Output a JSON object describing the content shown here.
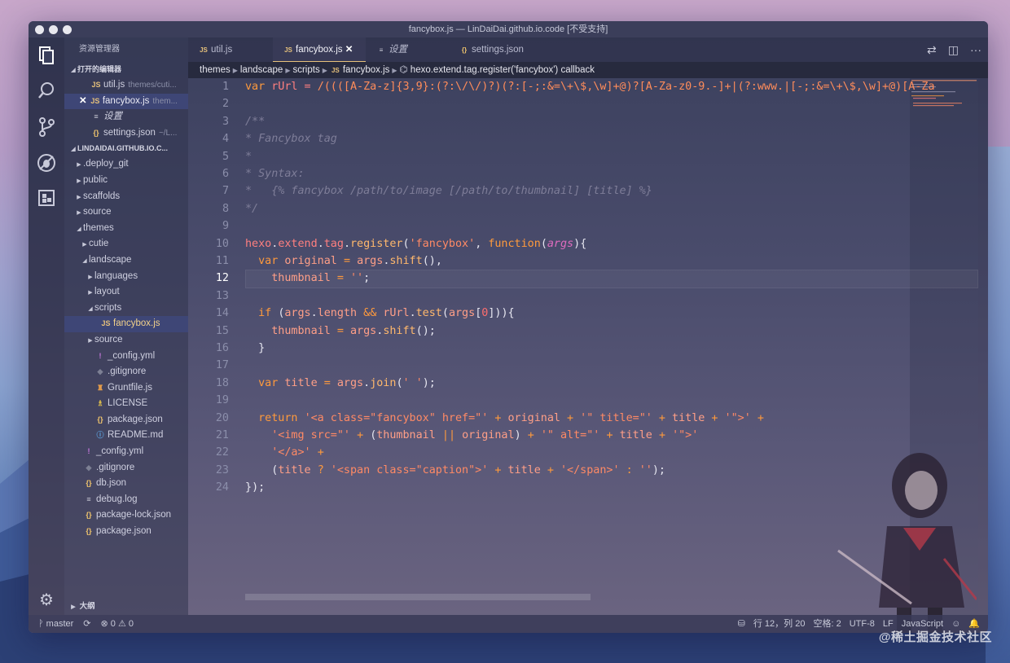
{
  "window": {
    "title": "fancybox.js — LinDaiDai.github.io.code [不受支持]"
  },
  "activity": {
    "explorer_icon": "files-icon",
    "search_icon": "search-icon",
    "git_icon": "source-control-icon",
    "debug_icon": "debug-icon",
    "extensions_icon": "extensions-icon",
    "settings_icon": "gear-icon"
  },
  "sidebar": {
    "header": "资源管理器",
    "open_editors_label": "打开的编辑器",
    "open_editors": [
      {
        "icon": "JS",
        "name": "util.js",
        "path": "themes/cuti...",
        "closeable": false
      },
      {
        "icon": "JS",
        "name": "fancybox.js",
        "path": "them...",
        "closeable": true
      },
      {
        "icon": "≡",
        "name": "设置",
        "path": "",
        "closeable": false
      },
      {
        "icon": "{}",
        "name": "settings.json",
        "path": "~/L...",
        "closeable": false
      }
    ],
    "project_label": "LINDAIDAI.GITHUB.IO.C...",
    "tree": [
      {
        "indent": 1,
        "twisty": "▶",
        "icon": "",
        "name": ".deploy_git"
      },
      {
        "indent": 1,
        "twisty": "▶",
        "icon": "",
        "name": "public"
      },
      {
        "indent": 1,
        "twisty": "▶",
        "icon": "",
        "name": "scaffolds"
      },
      {
        "indent": 1,
        "twisty": "▶",
        "icon": "",
        "name": "source"
      },
      {
        "indent": 1,
        "twisty": "◢",
        "icon": "",
        "name": "themes"
      },
      {
        "indent": 2,
        "twisty": "▶",
        "icon": "",
        "name": "cutie"
      },
      {
        "indent": 2,
        "twisty": "◢",
        "icon": "",
        "name": "landscape"
      },
      {
        "indent": 3,
        "twisty": "▶",
        "icon": "",
        "name": "languages"
      },
      {
        "indent": 3,
        "twisty": "▶",
        "icon": "",
        "name": "layout"
      },
      {
        "indent": 3,
        "twisty": "◢",
        "icon": "",
        "name": "scripts"
      },
      {
        "indent": 4,
        "twisty": "",
        "icon": "JS",
        "name": "fancybox.js",
        "active": true
      },
      {
        "indent": 3,
        "twisty": "▶",
        "icon": "",
        "name": "source"
      },
      {
        "indent": 3,
        "twisty": "",
        "icon": "!",
        "name": "_config.yml"
      },
      {
        "indent": 3,
        "twisty": "",
        "icon": "◆",
        "name": ".gitignore"
      },
      {
        "indent": 3,
        "twisty": "",
        "icon": "♜",
        "name": "Gruntfile.js"
      },
      {
        "indent": 3,
        "twisty": "",
        "icon": "♗",
        "name": "LICENSE"
      },
      {
        "indent": 3,
        "twisty": "",
        "icon": "{}",
        "name": "package.json"
      },
      {
        "indent": 3,
        "twisty": "",
        "icon": "ⓘ",
        "name": "README.md"
      },
      {
        "indent": 1,
        "twisty": "",
        "icon": "!",
        "name": "_config.yml"
      },
      {
        "indent": 1,
        "twisty": "",
        "icon": "◆",
        "name": ".gitignore"
      },
      {
        "indent": 1,
        "twisty": "",
        "icon": "{}",
        "name": "db.json"
      },
      {
        "indent": 1,
        "twisty": "",
        "icon": "≡",
        "name": "debug.log"
      },
      {
        "indent": 1,
        "twisty": "",
        "icon": "{}",
        "name": "package-lock.json"
      },
      {
        "indent": 1,
        "twisty": "",
        "icon": "{}",
        "name": "package.json"
      }
    ],
    "outline_label": "大纲"
  },
  "tabs": [
    {
      "icon": "JS",
      "label": "util.js",
      "active": false,
      "italic": false
    },
    {
      "icon": "JS",
      "label": "fancybox.js",
      "active": true,
      "italic": false
    },
    {
      "icon": "≡",
      "label": "设置",
      "active": false,
      "italic": true
    },
    {
      "icon": "{}",
      "label": "settings.json",
      "active": false,
      "italic": false
    }
  ],
  "breadcrumb": {
    "items": [
      "themes",
      "landscape",
      "scripts",
      "fancybox.js",
      "hexo.extend.tag.register('fancybox') callback"
    ]
  },
  "editor": {
    "current_line": 12,
    "lines": [
      {
        "n": "1",
        "code": "var rUrl = /((([A-Za-z]{3,9}:(?:\\/\\/)?)(?:[-;:&=\\+\\$,\\w]+@)?[A-Za-z0-9.-]+|(?:www.|[-;:&=\\+\\$,\\w]+@)[A-Za"
      },
      {
        "n": "2",
        "code": ""
      },
      {
        "n": "3",
        "code": "/**"
      },
      {
        "n": "4",
        "code": "* Fancybox tag"
      },
      {
        "n": "5",
        "code": "*"
      },
      {
        "n": "6",
        "code": "* Syntax:"
      },
      {
        "n": "7",
        "code": "*   {% fancybox /path/to/image [/path/to/thumbnail] [title] %}"
      },
      {
        "n": "8",
        "code": "*/"
      },
      {
        "n": "9",
        "code": ""
      },
      {
        "n": "10",
        "code": "hexo.extend.tag.register('fancybox', function(args){"
      },
      {
        "n": "11",
        "code": "  var original = args.shift(),"
      },
      {
        "n": "12",
        "code": "    thumbnail = '';"
      },
      {
        "n": "13",
        "code": ""
      },
      {
        "n": "14",
        "code": "  if (args.length && rUrl.test(args[0])){"
      },
      {
        "n": "15",
        "code": "    thumbnail = args.shift();"
      },
      {
        "n": "16",
        "code": "  }"
      },
      {
        "n": "17",
        "code": ""
      },
      {
        "n": "18",
        "code": "  var title = args.join(' ');"
      },
      {
        "n": "19",
        "code": ""
      },
      {
        "n": "20",
        "code": "  return '<a class=\"fancybox\" href=\"' + original + '\" title=\"' + title + '\">' +"
      },
      {
        "n": "21",
        "code": "    '<img src=\"' + (thumbnail || original) + '\" alt=\"' + title + '\">'"
      },
      {
        "n": "22",
        "code": "    '</a>' +"
      },
      {
        "n": "23",
        "code": "    (title ? '<span class=\"caption\">' + title + '</span>' : '');"
      },
      {
        "n": "24",
        "code": "});"
      }
    ]
  },
  "status": {
    "branch": "master",
    "errors": "0",
    "warnings": "0",
    "position": "行 12，列 20",
    "indent": "空格: 2",
    "encoding": "UTF-8",
    "eol": "LF",
    "language": "JavaScript"
  },
  "watermark": "@稀土掘金技术社区",
  "colors": {
    "accent": "#e5c07b",
    "keyword": "#ff9a3c",
    "string": "#ff8a65",
    "comment": "#7e7d98"
  }
}
